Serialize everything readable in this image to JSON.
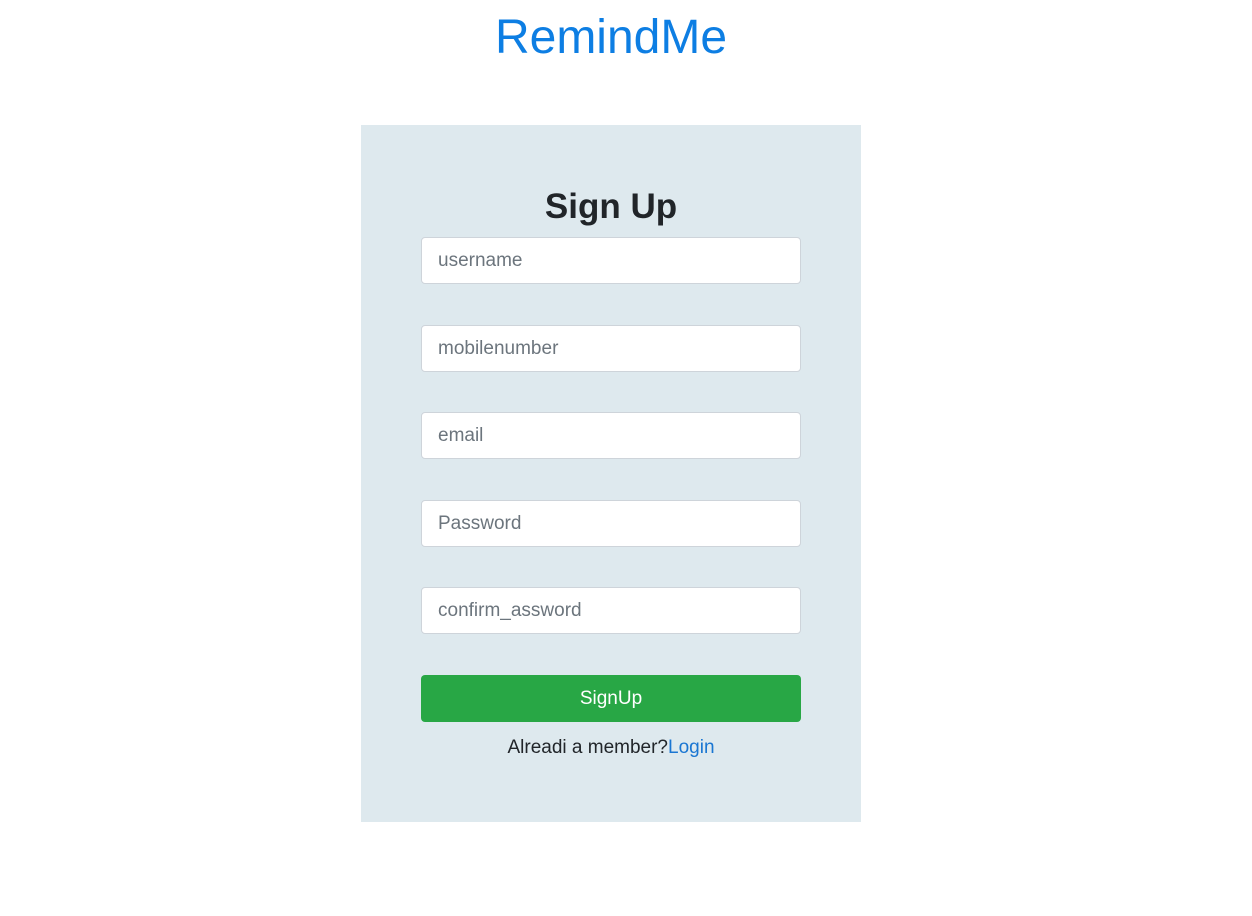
{
  "app": {
    "title": "RemindMe"
  },
  "colors": {
    "brand": "#0d7ee3",
    "panel_bg": "#dee9ee",
    "success": "#28a745",
    "link": "#1a76d2"
  },
  "form": {
    "heading": "Sign Up",
    "fields": [
      {
        "name": "username",
        "placeholder": "username",
        "value": ""
      },
      {
        "name": "mobilenumber",
        "placeholder": "mobilenumber",
        "value": ""
      },
      {
        "name": "email",
        "placeholder": "email",
        "value": ""
      },
      {
        "name": "password",
        "placeholder": "Password",
        "value": ""
      },
      {
        "name": "confirm_password",
        "placeholder": "confirm_assword",
        "value": ""
      }
    ],
    "submit_label": "SignUp",
    "member_prompt": "Alreadi a member?",
    "login_link": "Login"
  }
}
